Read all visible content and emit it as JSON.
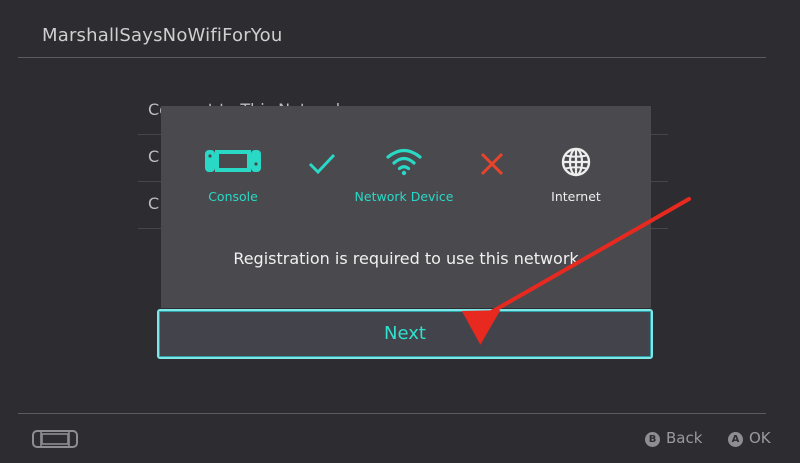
{
  "header": {
    "network_name": "MarshallSaysNoWifiForYou"
  },
  "background_list": {
    "items": [
      {
        "label": "Connect to This Network"
      },
      {
        "label": "C"
      },
      {
        "label": "C"
      }
    ]
  },
  "dialog": {
    "status": [
      {
        "label": "Console",
        "icon": "console-icon",
        "color": "#2ad8c6"
      },
      {
        "label": "Network Device",
        "icon": "wifi-icon",
        "color": "#2ad8c6"
      },
      {
        "label": "Internet",
        "icon": "globe-icon",
        "color": "#ededed"
      }
    ],
    "connection_console_to_device": {
      "state": "ok",
      "icon": "checkmark-icon",
      "color": "#2ad8c6"
    },
    "connection_device_to_internet": {
      "state": "failed",
      "icon": "x-icon",
      "color": "#e8432b"
    },
    "message": "Registration is required to use this network",
    "next_label": "Next"
  },
  "annotation": {
    "icon": "red-arrow-icon",
    "color": "#e8291f"
  },
  "footer": {
    "back_button_glyph": "B",
    "back_label": "Back",
    "ok_button_glyph": "A",
    "ok_label": "OK"
  },
  "colors": {
    "accent": "#2ad8c6",
    "background": "#2d2d31",
    "dialog": "#4a4a4e",
    "highlight": "#7ee7e8"
  }
}
